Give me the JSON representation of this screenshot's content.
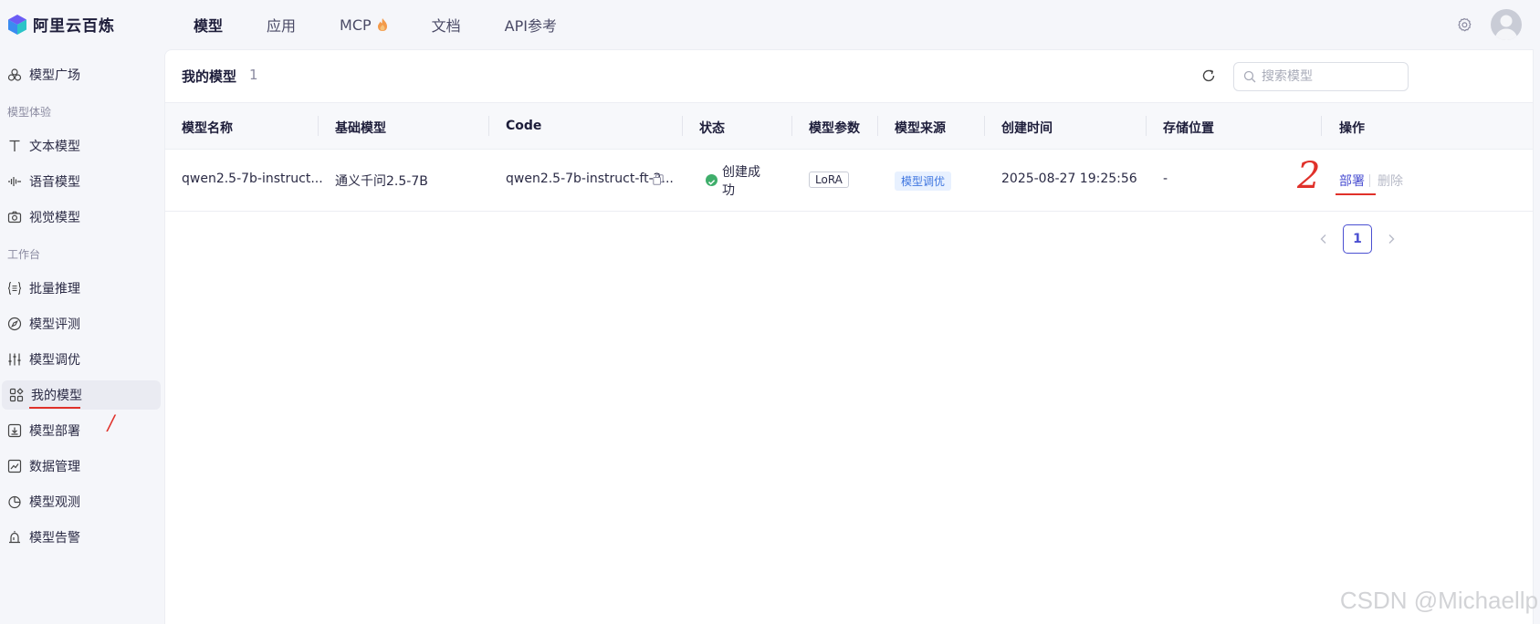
{
  "app": {
    "logo_text": "阿里云百炼"
  },
  "topnav": {
    "items": [
      {
        "label": "模型"
      },
      {
        "label": "应用"
      },
      {
        "label": "MCP"
      },
      {
        "label": "文档"
      },
      {
        "label": "API参考"
      }
    ]
  },
  "sidebar": {
    "model_square": "模型广场",
    "group_experience": "模型体验",
    "text_model": "文本模型",
    "voice_model": "语音模型",
    "vision_model": "视觉模型",
    "group_workbench": "工作台",
    "batch_inference": "批量推理",
    "model_eval": "模型评测",
    "model_tuning": "模型调优",
    "my_models": "我的模型",
    "model_deploy": "模型部署",
    "data_mgmt": "数据管理",
    "model_observe": "模型观测",
    "model_alert": "模型告警",
    "annotation_1": "/"
  },
  "main": {
    "title": "我的模型",
    "count": "1",
    "search_placeholder": "搜索模型"
  },
  "table": {
    "headers": {
      "name": "模型名称",
      "base": "基础模型",
      "code": "Code",
      "status": "状态",
      "params": "模型参数",
      "source": "模型来源",
      "created": "创建时间",
      "storage": "存储位置",
      "ops": "操作"
    },
    "rows": [
      {
        "name": "qwen2.5-7b-instruct...",
        "base": "通义千问2.5-7B",
        "code": "qwen2.5-7b-instruct-ft-2...",
        "status_line1": "创建成",
        "status_line2": "功",
        "params": "LoRA",
        "source": "模型调优",
        "created": "2025-08-27 19:25:56",
        "storage": "-",
        "op_deploy": "部署",
        "op_delete": "删除"
      }
    ],
    "annotation_2": "2"
  },
  "pagination": {
    "current": "1"
  },
  "watermark": "CSDN @Michaellp",
  "colors": {
    "accent": "#4a4fd1",
    "success": "#3fae6b",
    "annotation": "#e0312a"
  }
}
